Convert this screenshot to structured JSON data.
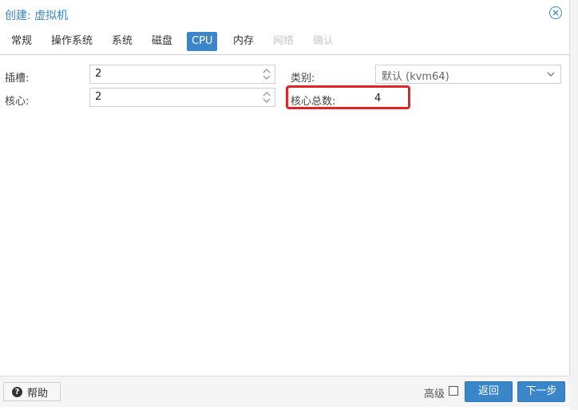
{
  "window": {
    "title": "创建: 虚拟机"
  },
  "tabs": [
    {
      "label": "常规",
      "state": "normal"
    },
    {
      "label": "操作系统",
      "state": "normal"
    },
    {
      "label": "系统",
      "state": "normal"
    },
    {
      "label": "磁盘",
      "state": "normal"
    },
    {
      "label": "CPU",
      "state": "active"
    },
    {
      "label": "内存",
      "state": "normal"
    },
    {
      "label": "网络",
      "state": "disabled"
    },
    {
      "label": "确认",
      "state": "disabled"
    }
  ],
  "form": {
    "sockets_label": "插槽:",
    "sockets_value": "2",
    "cores_label": "核心:",
    "cores_value": "2",
    "type_label": "类别:",
    "type_value": "默认 (kvm64)",
    "total_cores_label": "核心总数:",
    "total_cores_value": "4"
  },
  "footer": {
    "help_label": "帮助",
    "advanced_label": "高级",
    "back_label": "返回",
    "next_label": "下一步"
  },
  "colors": {
    "accent": "#3a86c8",
    "highlight": "#e02424"
  },
  "icons": {
    "close": "close-icon",
    "help": "help-icon",
    "spinner": "spinner-arrows-icon",
    "dropdown": "chevron-down-icon"
  }
}
